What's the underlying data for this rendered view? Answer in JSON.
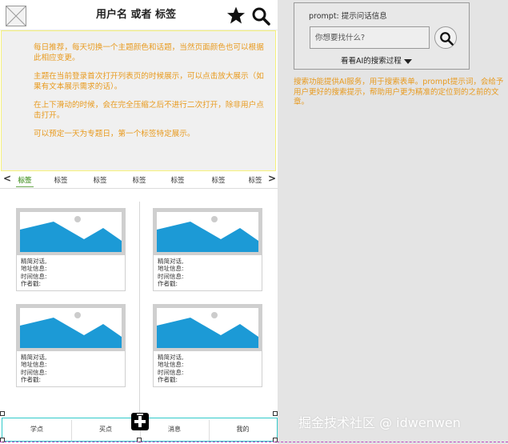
{
  "header": {
    "title": "用户名 或者 标签",
    "star_icon": "star-icon",
    "search_icon": "search-icon"
  },
  "banner": {
    "paragraphs": [
      "每日推荐，每天切换一个主题颜色和话题，当然页面颜色也可以根据此相应变更。",
      "主题在当前登录首次打开列表页的时候展示，可以点击放大展示（如果有文本展示需求的话）。",
      "在上下滑动的时候，会在完全压缩之后不进行二次打开，除非用户点击打开。",
      "可以预定一天为专题日，第一个标签特定展示。"
    ]
  },
  "tabs": {
    "left_arrow": "<",
    "right_arrow": ">",
    "items": [
      "标签",
      "标签",
      "标签",
      "标签",
      "标签",
      "标签",
      "标签"
    ],
    "active_index": 0
  },
  "cards": [
    {
      "l1": "精简对话,",
      "l2": "地址信息:",
      "l3": "时间信息:",
      "l4": "作者戳:"
    },
    {
      "l1": "精简对话,",
      "l2": "地址信息:",
      "l3": "时间信息:",
      "l4": "作者戳:"
    },
    {
      "l1": "精简对话,",
      "l2": "地址信息:",
      "l3": "时间信息:",
      "l4": "作者戳:"
    },
    {
      "l1": "精简对话,",
      "l2": "地址信息:",
      "l3": "时间信息:",
      "l4": "作者戳:"
    }
  ],
  "bottom_nav": {
    "items": [
      "学点",
      "买点",
      "消息",
      "我的"
    ]
  },
  "prompt": {
    "label": "prompt: 提示问话信息",
    "placeholder": "你想要找什么?",
    "toggle": "看看AI的搜索过程",
    "description": "搜索功能提供AI服务，用于搜索表单。prompt提示词，会给予用户更好的搜索提示，帮助用户更为精准的定位到的之前的文章。"
  },
  "watermark": "掘金技术社区 @ idwenwen",
  "colors": {
    "banner_text": "#e89a1e",
    "active_tab": "#6aa84f",
    "image_blue": "#1c9ad6",
    "nav_border": "#31c9c9"
  }
}
